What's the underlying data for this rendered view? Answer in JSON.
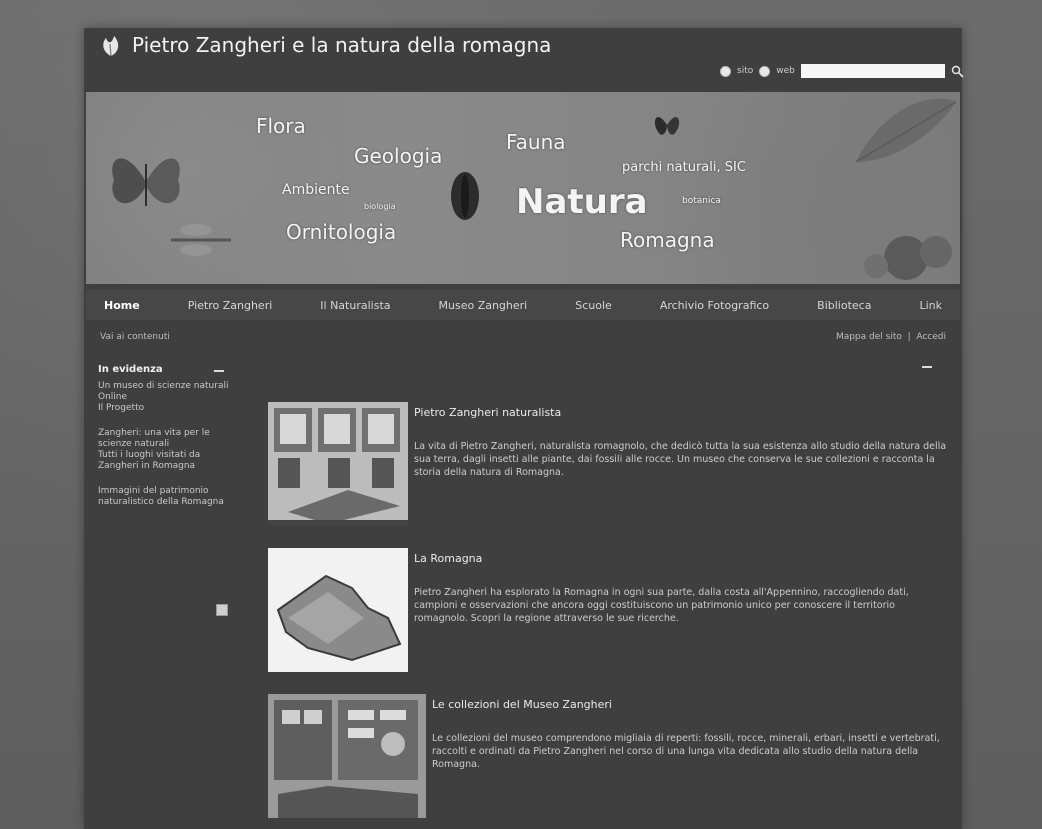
{
  "site": {
    "title": "Pietro Zangheri e la natura della romagna"
  },
  "search": {
    "option_1": "sito",
    "option_2": "web",
    "placeholder": ""
  },
  "banner": {
    "words": [
      "Flora",
      "Geologia",
      "Fauna",
      "parchi naturali, SIC",
      "Ambiente",
      "Natura",
      "Ornitologia",
      "Romagna",
      "botanica",
      "biologia"
    ]
  },
  "nav": {
    "items": [
      "Home",
      "Pietro Zangheri",
      "Il Naturalista",
      "Museo Zangheri",
      "Scuole",
      "Archivio Fotografico",
      "Biblioteca",
      "Link"
    ]
  },
  "subbar": {
    "left": "Vai ai contenuti",
    "right": "Mappa del sito",
    "right_extra": "Accedi"
  },
  "sidebar": {
    "title": "In evidenza",
    "groups": [
      [
        "Un museo di scienze naturali",
        "Online",
        "Il Progetto"
      ],
      [
        "Zangheri: una vita per le scienze naturali",
        "Tutti i luoghi visitati da Zangheri in Romagna"
      ],
      [
        "Immagini del patrimonio naturalistico della Romagna"
      ]
    ]
  },
  "articles": [
    {
      "title": "Pietro Zangheri naturalista",
      "body": "La vita di Pietro Zangheri, naturalista romagnolo, che dedicò tutta la sua esistenza allo studio della natura della sua terra, dagli insetti alle piante, dai fossili alle rocce. Un museo che conserva le sue collezioni e racconta la storia della natura di Romagna."
    },
    {
      "title": "La Romagna",
      "body": "Pietro Zangheri ha esplorato la Romagna in ogni sua parte, dalla costa all'Appennino, raccogliendo dati, campioni e osservazioni che ancora oggi costituiscono un patrimonio unico per conoscere il territorio romagnolo. Scopri la regione attraverso le sue ricerche."
    },
    {
      "title": "Le collezioni del Museo Zangheri",
      "body": "Le collezioni del museo comprendono migliaia di reperti: fossili, rocce, minerali, erbari, insetti e vertebrati, raccolti e ordinati da Pietro Zangheri nel corso di una lunga vita dedicata allo studio della natura della Romagna."
    }
  ]
}
